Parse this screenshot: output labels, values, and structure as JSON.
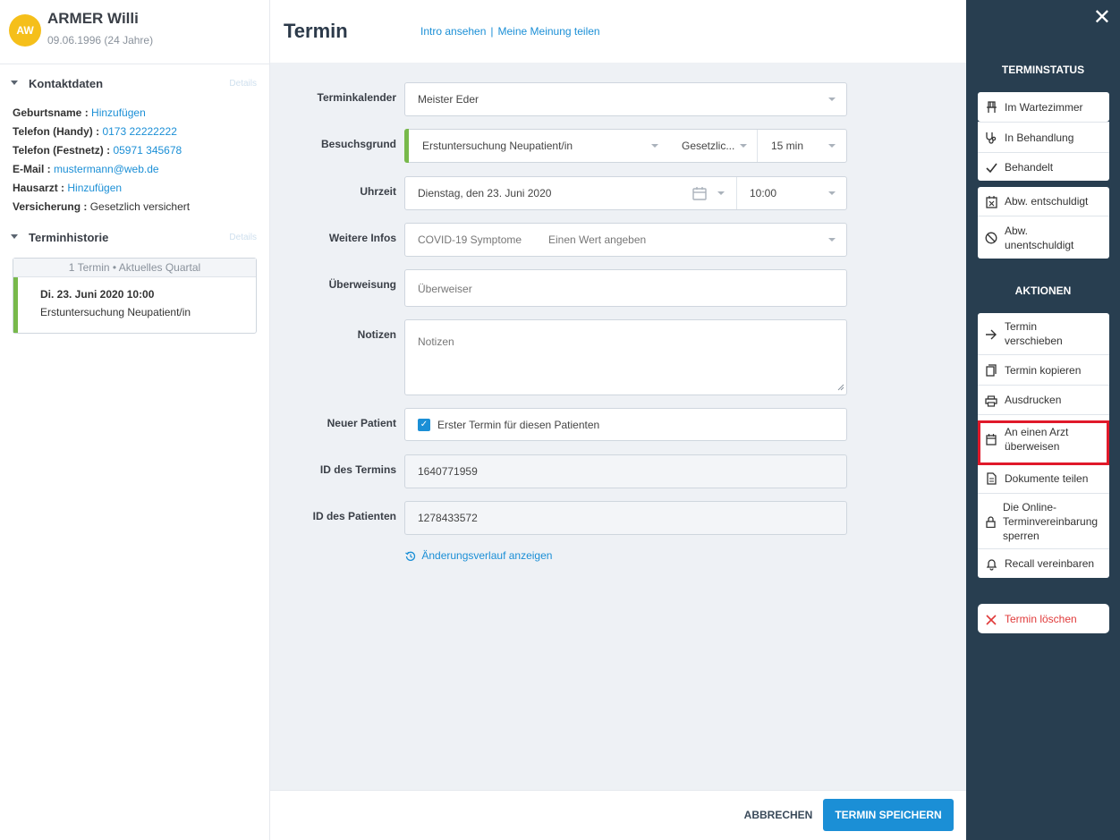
{
  "patient": {
    "initials": "AW",
    "name": "ARMER Willi",
    "dob": "09.06.1996 (24 Jahre)"
  },
  "contact": {
    "title": "Kontaktdaten",
    "details_link": "Details",
    "rows": [
      {
        "label": "Geburtsname :",
        "value": "Hinzufügen",
        "link": true
      },
      {
        "label": "Telefon (Handy) :",
        "value": "0173 22222222",
        "link": true
      },
      {
        "label": "Telefon (Festnetz) :",
        "value": "05971 345678",
        "link": true
      },
      {
        "label": "E-Mail :",
        "value": "mustermann@web.de",
        "link": true
      },
      {
        "label": "Hausarzt :",
        "value": "Hinzufügen",
        "link": true
      },
      {
        "label": "Versicherung :",
        "value": "Gesetzlich versichert",
        "link": false
      }
    ]
  },
  "history": {
    "title": "Terminhistorie",
    "details_link": "Details",
    "caption": "1 Termin • Aktuelles Quartal",
    "item_date": "Di. 23. Juni 2020 10:00",
    "item_desc": "Erstuntersuchung Neupatient/in"
  },
  "header": {
    "title": "Termin",
    "link_intro": "Intro ansehen",
    "link_separator": "|",
    "link_feedback": "Meine Meinung teilen"
  },
  "form": {
    "calendar_label": "Terminkalender",
    "calendar_value": "Meister Eder",
    "reason_label": "Besuchsgrund",
    "reason_value": "Erstuntersuchung Neupatient/in",
    "insurance_value": "Gesetzlic...",
    "duration_value": "15 min",
    "time_label": "Uhrzeit",
    "date_value": "Dienstag, den 23. Juni 2020",
    "time_value": "10:00",
    "info_label": "Weitere Infos",
    "info_value": "COVID-19 Symptome",
    "info_placeholder": "Einen Wert angeben",
    "referral_label": "Überweisung",
    "referral_placeholder": "Überweiser",
    "notes_label": "Notizen",
    "notes_placeholder": "Notizen",
    "newpatient_label": "Neuer Patient",
    "newpatient_text": "Erster Termin für diesen Patienten",
    "apptid_label": "ID des Termins",
    "apptid_value": "1640771959",
    "patid_label": "ID des Patienten",
    "patid_value": "1278433572",
    "history_link": "Änderungsverlauf anzeigen"
  },
  "footer": {
    "cancel": "ABBRECHEN",
    "save": "TERMIN SPEICHERN"
  },
  "sidebar": {
    "close": "✕",
    "status_title": "TERMINSTATUS",
    "status": [
      {
        "label": "Im Wartezimmer",
        "icon": "chair-icon"
      },
      {
        "label": "In Behandlung",
        "icon": "stethoscope-icon"
      },
      {
        "label": "Behandelt",
        "icon": "check-icon"
      }
    ],
    "absence": [
      {
        "label": "Abw. entschuldigt",
        "icon": "calendar-x-icon"
      },
      {
        "label": "Abw. unentschuldigt",
        "icon": "forbidden-icon"
      }
    ],
    "actions_title": "AKTIONEN",
    "actions": [
      {
        "label": "Termin verschieben",
        "icon": "arrow-right-icon"
      },
      {
        "label": "Termin kopieren",
        "icon": "copy-icon"
      },
      {
        "label": "Ausdrucken",
        "icon": "printer-icon"
      },
      {
        "label": "An einen Arzt überweisen",
        "icon": "calendar-icon"
      },
      {
        "label": "Dokumente teilen",
        "icon": "document-icon"
      },
      {
        "label": "Die Online-Terminvereinbarung sperren",
        "icon": "lock-icon"
      },
      {
        "label": "Recall vereinbaren",
        "icon": "bell-icon"
      }
    ],
    "delete": {
      "label": "Termin löschen",
      "icon": "x-icon"
    }
  },
  "colors": {
    "accent": "#1b8fd6",
    "sidebar": "#283e50",
    "highlight": "#e0192a",
    "status_green": "#78b94b",
    "avatar": "#f5bf1a"
  }
}
